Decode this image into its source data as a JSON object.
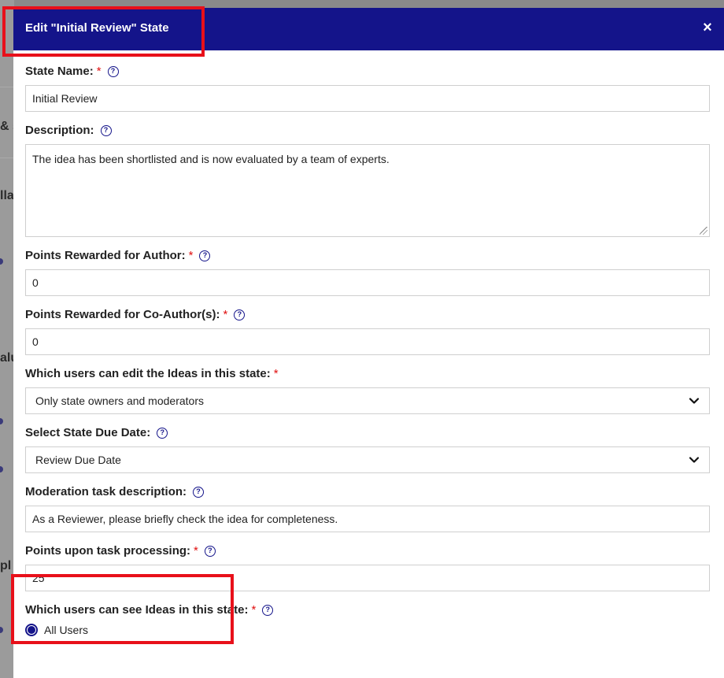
{
  "modal": {
    "title": "Edit \"Initial Review\" State",
    "close_symbol": "×"
  },
  "fields": {
    "state_name": {
      "label": "State Name:",
      "required": "*",
      "value": "Initial Review"
    },
    "description": {
      "label": "Description:",
      "value": "The idea has been shortlisted and is now evaluated by a team of experts."
    },
    "points_author": {
      "label": "Points Rewarded for Author:",
      "required": "*",
      "value": "0"
    },
    "points_coauthor": {
      "label": "Points Rewarded for Co-Author(s):",
      "required": "*",
      "value": "0"
    },
    "edit_users": {
      "label": "Which users can edit the Ideas in this state:",
      "required": "*",
      "selected": "Only state owners and moderators"
    },
    "due_date": {
      "label": "Select State Due Date:",
      "selected": "Review Due Date"
    },
    "moderation_task": {
      "label": "Moderation task description:",
      "value": "As a Reviewer, please briefly check the idea for completeness."
    },
    "points_task": {
      "label": "Points upon task processing:",
      "required": "*",
      "value": "25"
    },
    "see_users": {
      "label": "Which users can see Ideas in this state:",
      "required": "*",
      "option": "All Users"
    }
  },
  "background": {
    "fragments": [
      "& s",
      "lla",
      "alu",
      "pl"
    ]
  },
  "colors": {
    "header": "#14148a",
    "required": "#e01010",
    "highlight": "#e8101a"
  },
  "icons": {
    "help": "question-circle-icon",
    "close": "close-icon",
    "chevron": "chevron-down-icon"
  }
}
